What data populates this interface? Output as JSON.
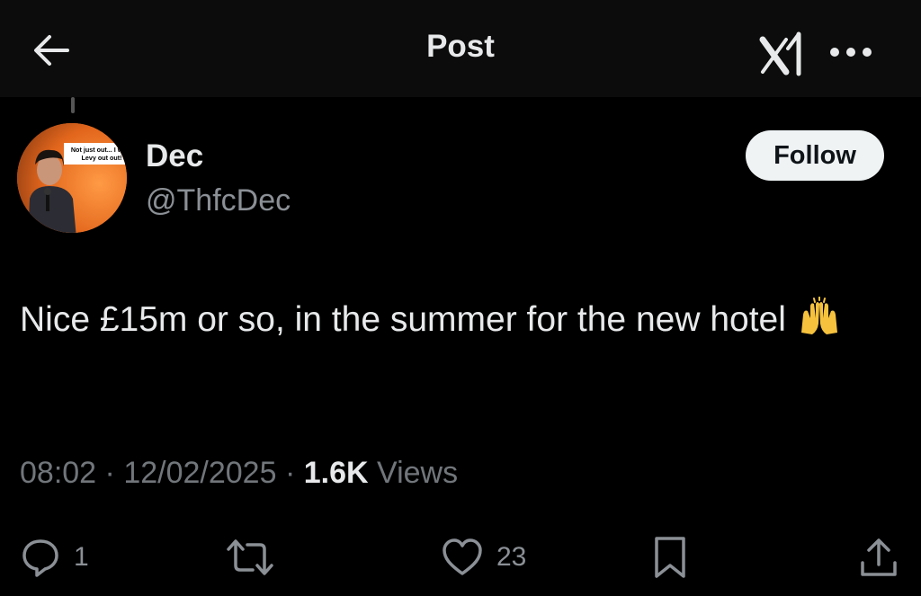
{
  "header": {
    "title": "Post",
    "back_icon": "arrow-left-icon",
    "brand_icon": "x-logo-icon",
    "more_icon": "more-horizontal-icon"
  },
  "author": {
    "name": "Dec",
    "handle": "@ThfcDec",
    "avatar_sign": "Not just out... I want Levy out out!",
    "follow_label": "Follow"
  },
  "tweet": {
    "text": "Nice £15m or so, in the summer for the new hotel",
    "emoji": "raising-hands-emoji"
  },
  "meta": {
    "time": "08:02",
    "separator": "·",
    "date": "12/02/2025",
    "views_count": "1.6K",
    "views_label": "Views"
  },
  "actions": {
    "reply_count": "1",
    "likes_count": "23",
    "reply_icon": "reply-icon",
    "repost_icon": "repost-icon",
    "like_icon": "heart-icon",
    "bookmark_icon": "bookmark-icon",
    "share_icon": "share-icon"
  },
  "colors": {
    "background": "#000000",
    "text": "#e7e9ea",
    "muted": "#71767b",
    "follow_bg": "#eff3f4"
  }
}
